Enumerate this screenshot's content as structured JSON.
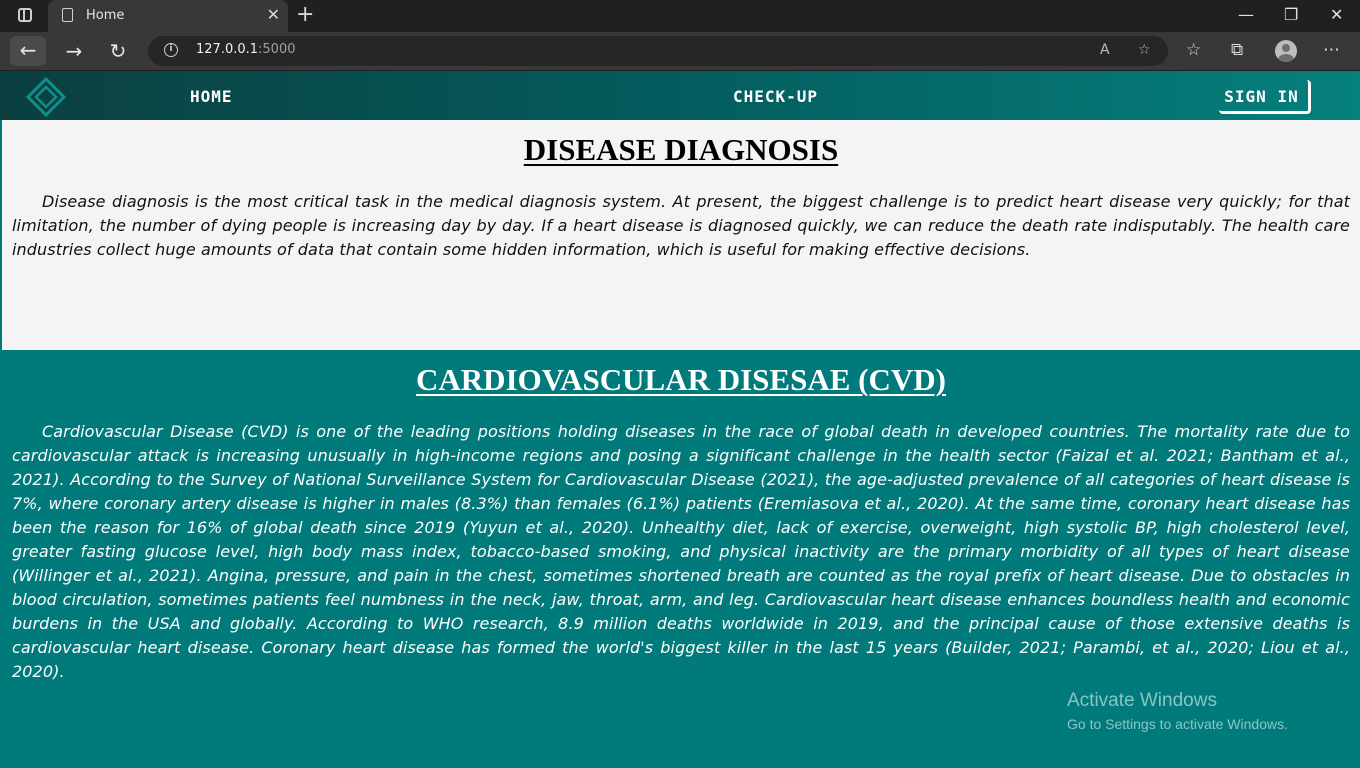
{
  "browser": {
    "tab_title": "Home",
    "url_host": "127.0.0.1",
    "url_port": ":5000"
  },
  "nav": {
    "home": "HOME",
    "checkup": "CHECK-UP",
    "signin": "SIGN IN"
  },
  "section1": {
    "title": "DISEASE DIAGNOSIS",
    "body": "Disease diagnosis is the most critical task in the medical diagnosis system. At present, the biggest challenge is to predict heart disease very quickly; for that limitation, the number of dying people is increasing day by day. If a heart disease is diagnosed quickly, we can reduce the death rate indisputably. The health care industries collect huge amounts of data that contain some hidden information, which is useful for making effective decisions."
  },
  "section2": {
    "title": "CARDIOVASCULAR DISESAE (CVD)",
    "body": "Cardiovascular Disease (CVD) is one of the leading positions holding diseases in the race of global death in developed countries. The mortality rate due to cardiovascular attack is increasing unusually in high-income regions and posing a significant challenge in the health sector (Faizal et al. 2021; Bantham et al., 2021). According to the Survey of National Surveillance System for Cardiovascular Disease (2021), the age-adjusted prevalence of all categories of heart disease is 7%, where coronary artery disease is higher in males (8.3%) than females (6.1%) patients (Eremiasova et al., 2020). At the same time, coronary heart disease has been the reason for 16% of global death since 2019 (Yuyun et al., 2020). Unhealthy diet, lack of exercise, overweight, high systolic BP, high cholesterol level, greater fasting glucose level, high body mass index, tobacco-based smoking, and physical inactivity are the primary morbidity of all types of heart disease (Willinger et al., 2021). Angina, pressure, and pain in the chest, sometimes shortened breath are counted as the royal prefix of heart disease. Due to obstacles in blood circulation, sometimes patients feel numbness in the neck, jaw, throat, arm, and leg. Cardiovascular heart disease enhances boundless health and economic burdens in the USA and globally. According to WHO research, 8.9 million deaths worldwide in 2019, and the principal cause of those extensive deaths is cardiovascular heart disease. Coronary heart disease has formed the world's biggest killer in the last 15 years (Builder, 2021; Parambi, et al., 2020; Liou et al., 2020)."
  },
  "watermark": {
    "line1": "Activate Windows",
    "line2": "Go to Settings to activate Windows."
  },
  "colors": {
    "teal": "#007a7a",
    "light_bg": "#f5f4f4"
  }
}
